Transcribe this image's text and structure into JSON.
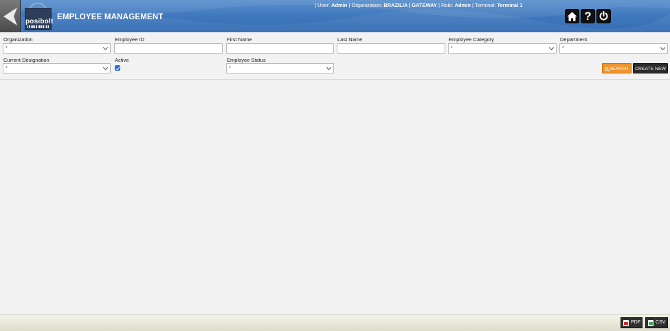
{
  "header": {
    "title": "EMPLOYEE MANAGEMENT",
    "logo_text": "posibolt",
    "session": {
      "user_label": "| User:",
      "user": "Admin",
      "org_label": "| Organization:",
      "org": "BRAZILIA | GATEWAY",
      "role_label": "| Role:",
      "role": "Admin",
      "terminal_label": "| Terminal:",
      "terminal": "Terminal 1"
    },
    "icons": [
      "home-icon",
      "help-icon",
      "power-icon"
    ],
    "help_glyph": "?"
  },
  "form": {
    "organization": {
      "label": "Organization",
      "value": "*"
    },
    "employee_id": {
      "label": "Employee ID",
      "value": ""
    },
    "first_name": {
      "label": "First Name",
      "value": ""
    },
    "last_name": {
      "label": "Last Name",
      "value": ""
    },
    "employee_category": {
      "label": "Employee Category",
      "value": "*"
    },
    "department": {
      "label": "Department",
      "value": "*"
    },
    "current_designation": {
      "label": "Current Designation",
      "value": "*"
    },
    "active": {
      "label": "Active",
      "checked": true
    },
    "employee_status": {
      "label": "Employee Status",
      "value": "*"
    }
  },
  "actions": {
    "search": "SEARCH",
    "create_new": "CREATE NEW"
  },
  "footer": {
    "pdf": "PDF",
    "csv": "CSV"
  },
  "colors": {
    "header_blue": "#3f78bd",
    "search_orange": "#f0932b",
    "dark_button": "#2b2b2b",
    "checkbox_blue": "#1a73e8"
  }
}
